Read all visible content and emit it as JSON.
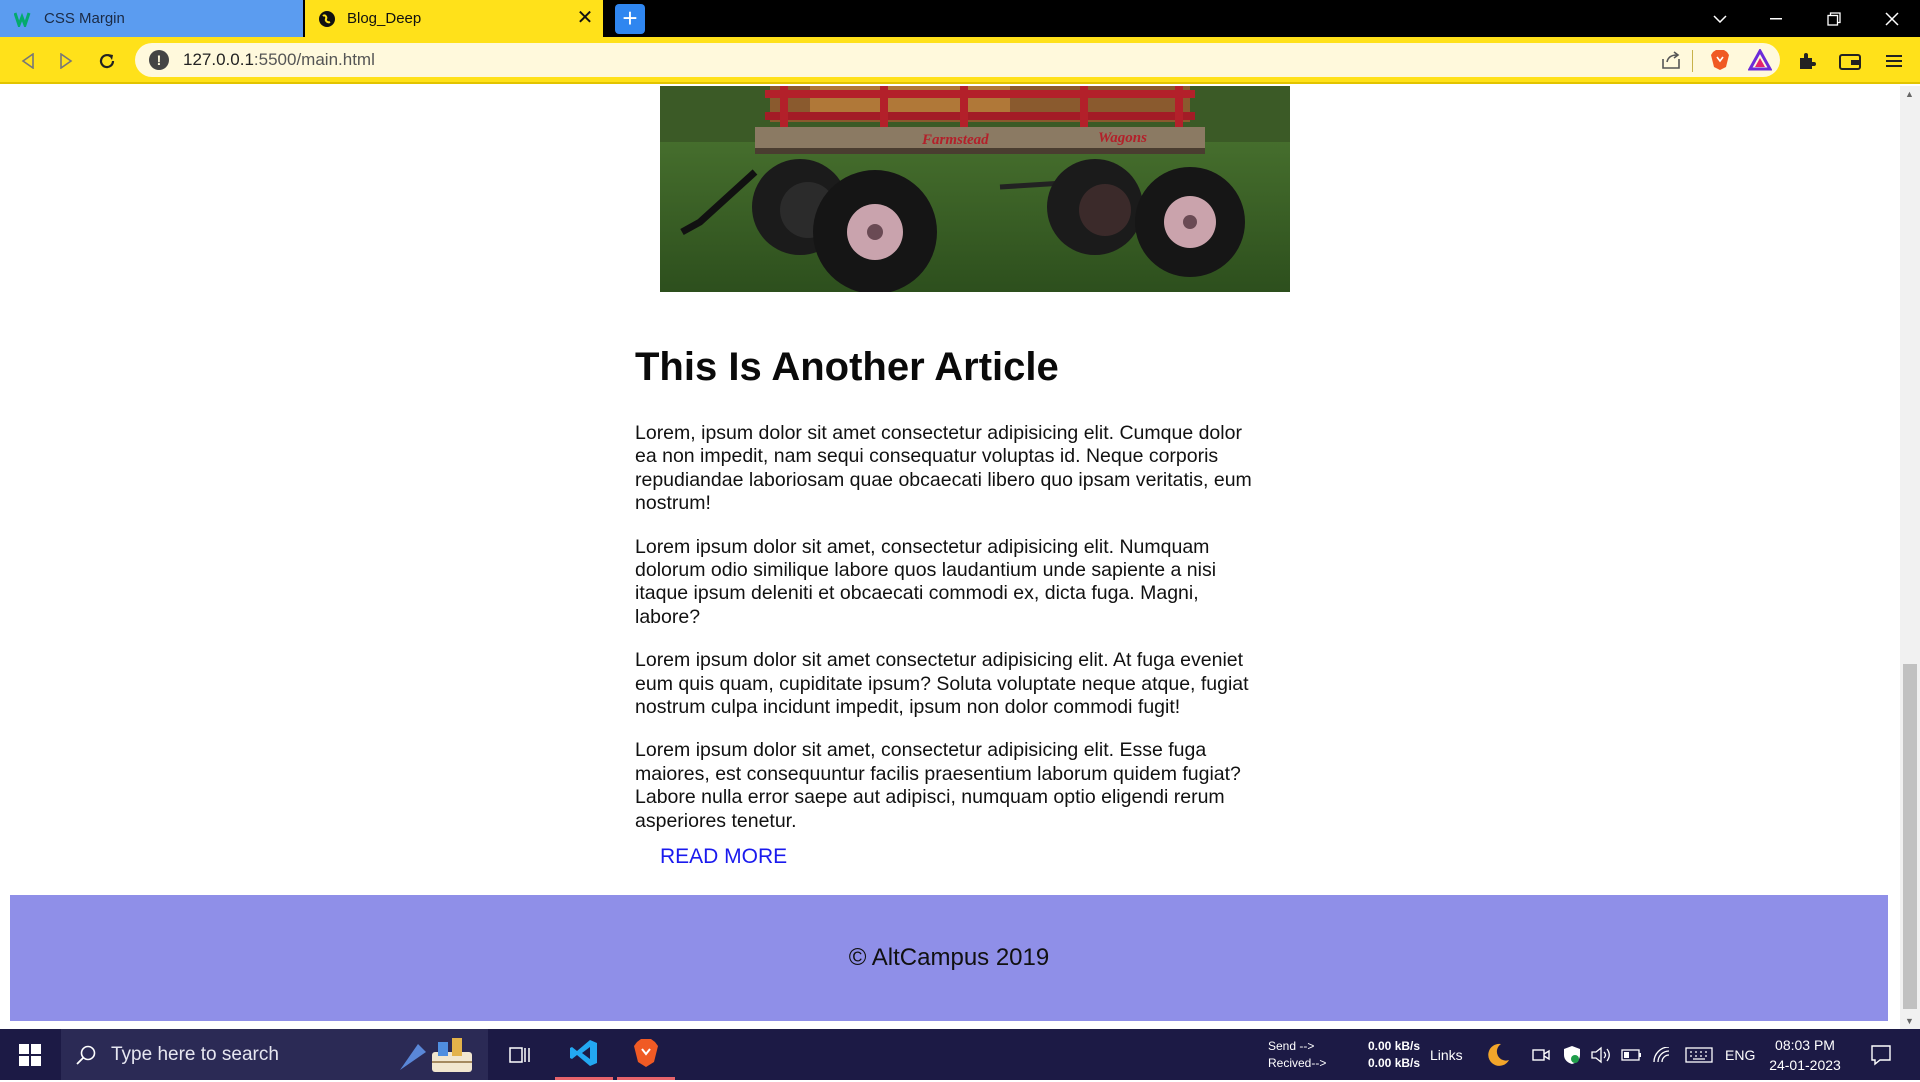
{
  "browser": {
    "tabs": [
      {
        "title": "CSS Margin",
        "active": false
      },
      {
        "title": "Blog_Deep",
        "active": true
      }
    ],
    "new_tab_label": "+",
    "url_host": "127.0.0.1",
    "url_path": ":5500/main.html"
  },
  "article": {
    "title": "This Is Another Article",
    "paragraphs": [
      "Lorem, ipsum dolor sit amet consectetur adipisicing elit. Cumque dolor ea non impedit, nam sequi consequatur voluptas id. Neque corporis repudiandae laboriosam quae obcaecati libero quo ipsam veritatis, eum nostrum!",
      "Lorem ipsum dolor sit amet, consectetur adipisicing elit. Numquam dolorum odio similique labore quos laudantium unde sapiente a nisi itaque ipsum deleniti et obcaecati commodi ex, dicta fuga. Magni, labore?",
      "Lorem ipsum dolor sit amet consectetur adipisicing elit. At fuga eveniet eum quis quam, cupiditate ipsum? Soluta voluptate neque atque, fugiat nostrum culpa incidunt impedit, ipsum non dolor commodi fugit!",
      "Lorem ipsum dolor sit amet, consectetur adipisicing elit. Esse fuga maiores, est consequuntur facilis praesentium laborum quidem fugiat? Labore nulla error saepe aut adipisci, numquam optio eligendi rerum asperiores tenetur."
    ],
    "read_more": "READ MORE",
    "wagon_text_left": "Farmstead",
    "wagon_text_right": "Wagons"
  },
  "footer": {
    "text": "© AltCampus 2019"
  },
  "taskbar": {
    "search_placeholder": "Type here to search",
    "net_send_label": "Send -->",
    "net_recv_label": "Recived-->",
    "net_send_value": "0.00 kB/s",
    "net_recv_value": "0.00 kB/s",
    "links_label": "Links",
    "language": "ENG",
    "time": "08:03 PM",
    "date": "24-01-2023"
  },
  "colors": {
    "tab_active": "#ffe11a",
    "tab_inactive": "#5b9cf0",
    "footer_bg": "#8f8fe8",
    "link": "#1a1aee",
    "taskbar": "#1c1a45"
  }
}
